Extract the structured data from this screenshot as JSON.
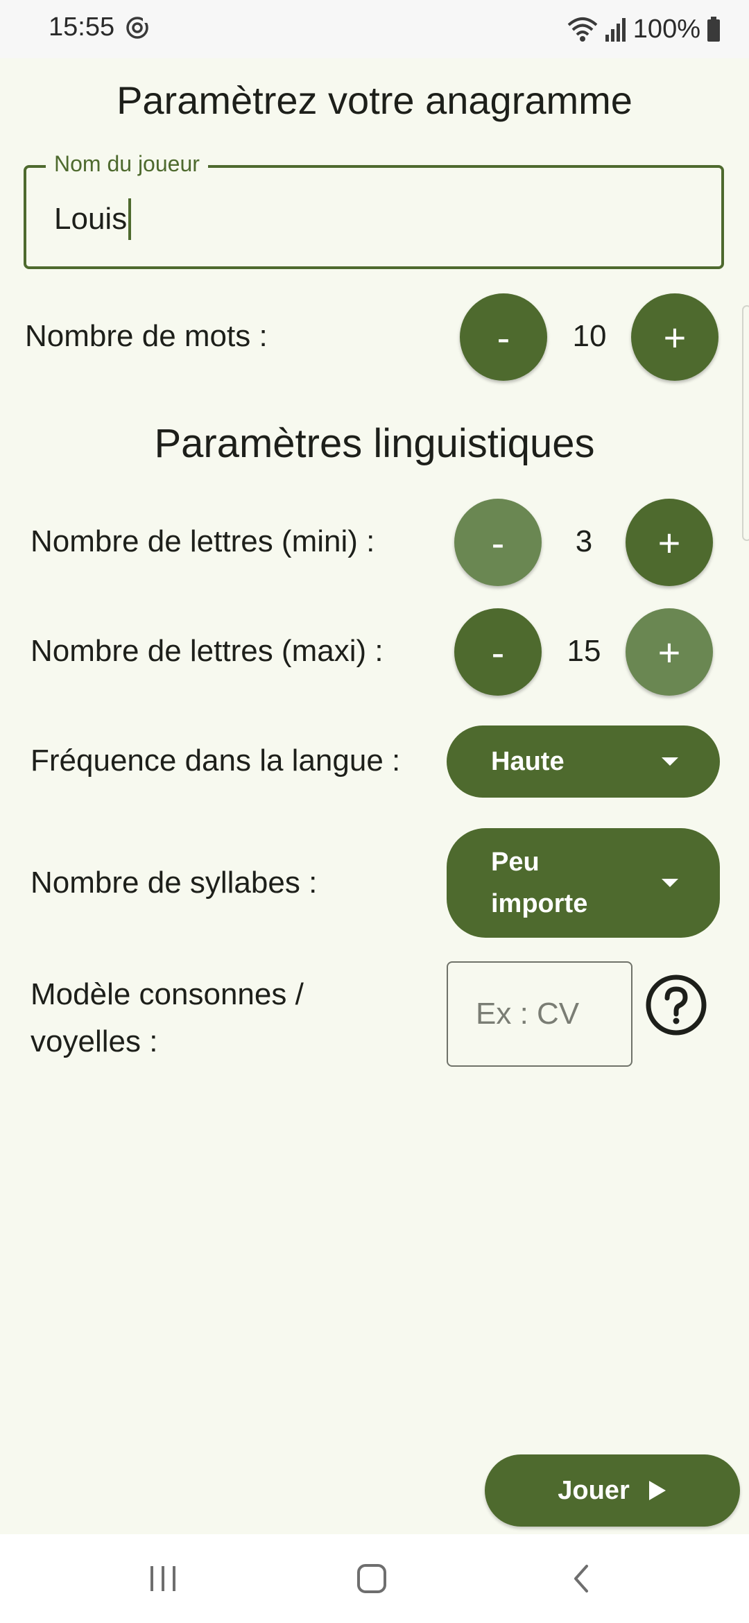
{
  "status_bar": {
    "time": "15:55",
    "battery": "100%",
    "icons": [
      "sync-icon",
      "wifi-icon",
      "signal-icon",
      "battery-icon"
    ]
  },
  "page": {
    "title": "Paramètrez votre anagramme"
  },
  "player": {
    "label": "Nom du joueur",
    "value": "Louis"
  },
  "words": {
    "label": "Nombre de mots :",
    "value": "10",
    "minus": "-",
    "plus": "+"
  },
  "linguistic": {
    "title": "Paramètres linguistiques",
    "min_letters": {
      "label": "Nombre de lettres (mini) :",
      "value": "3",
      "minus": "-",
      "plus": "+"
    },
    "max_letters": {
      "label": "Nombre de lettres (maxi) :",
      "value": "15",
      "minus": "-",
      "plus": "+"
    },
    "frequency": {
      "label": "Fréquence dans la langue :",
      "selected": "Haute"
    },
    "syllables": {
      "label": "Nombre de syllabes :",
      "selected_line1": "Peu",
      "selected_line2": "importe"
    },
    "pattern": {
      "label_line1": "Modèle consonnes /",
      "label_line2": "voyelles :",
      "value": "",
      "placeholder": "Ex : CV"
    }
  },
  "actions": {
    "play_label": "Jouer"
  },
  "colors": {
    "accent": "#4e6a2e",
    "accent_disabled": "#6a8752",
    "background": "#f7f9ef",
    "text": "#1d1f1a"
  }
}
